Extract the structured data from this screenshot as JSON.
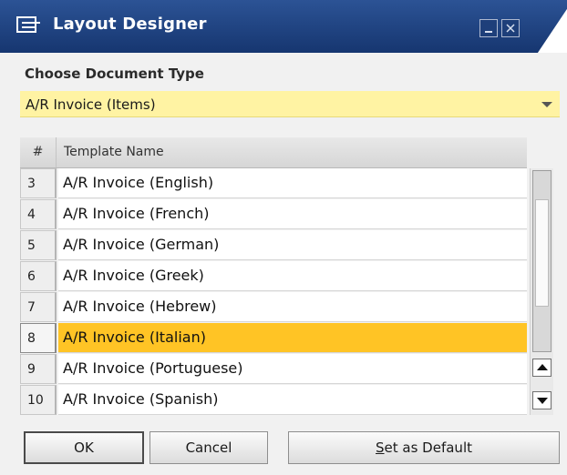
{
  "window": {
    "title": "Layout Designer",
    "title_icon": "layout-designer-icon",
    "buttons": [
      "minimize-icon",
      "close-icon"
    ]
  },
  "document_type": {
    "label": "Choose Document Type",
    "selected": "A/R Invoice (Items)"
  },
  "grid": {
    "columns": [
      "#",
      "Template Name"
    ],
    "rows": [
      {
        "num": "3",
        "name": "A/R Invoice (English)"
      },
      {
        "num": "4",
        "name": "A/R Invoice (French)"
      },
      {
        "num": "5",
        "name": "A/R Invoice (German)"
      },
      {
        "num": "6",
        "name": "A/R Invoice (Greek)"
      },
      {
        "num": "7",
        "name": "A/R Invoice (Hebrew)"
      },
      {
        "num": "8",
        "name": "A/R Invoice (Italian)"
      },
      {
        "num": "9",
        "name": "A/R Invoice (Portuguese)"
      },
      {
        "num": "10",
        "name": "A/R Invoice (Spanish)"
      }
    ],
    "selected_row": "8"
  },
  "buttons": {
    "ok": "OK",
    "cancel": "Cancel",
    "set_default_first": "S",
    "set_default_rest": "et as Default"
  },
  "colors": {
    "title_bar": "#1e3f7a",
    "selected_row": "#ffc425",
    "select_field": "#fff3a3"
  }
}
